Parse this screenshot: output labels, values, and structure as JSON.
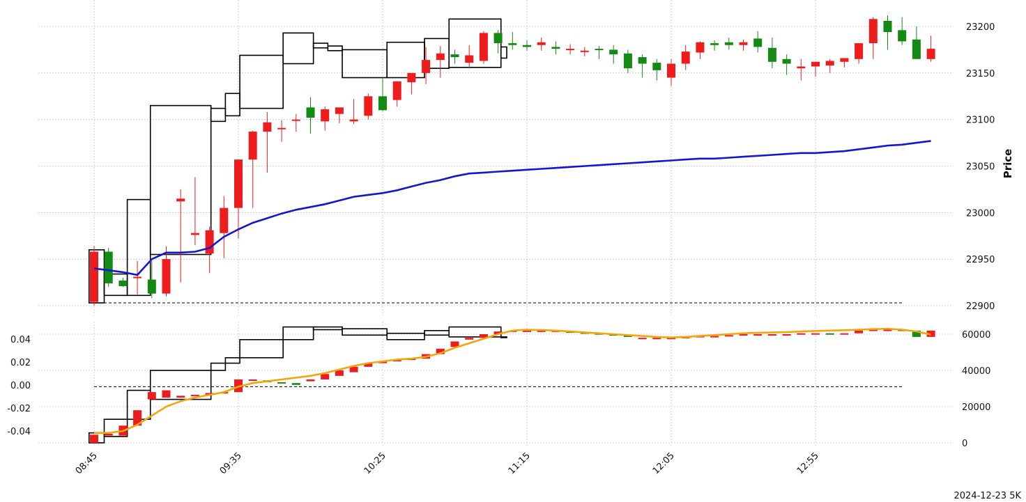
{
  "footer": "2024-12-23 5K",
  "colors": {
    "up": "#ee1c1c",
    "down": "#138a13",
    "ma": "#1414d4",
    "cum": "#f5a40c",
    "box": "#000000",
    "grid": "#b0b0b0"
  },
  "chart_data": [
    {
      "type": "candlestick",
      "title": "",
      "xlabel": "",
      "ylabel": "Price",
      "ylim": [
        22890,
        23230
      ],
      "yticks": [
        22900,
        22950,
        23000,
        23050,
        23100,
        23150,
        23200
      ],
      "xticks": [
        "08:45",
        "09:35",
        "10:25",
        "11:15",
        "12:05",
        "12:55"
      ],
      "grid": true,
      "reference_line": 22903,
      "time": [
        "08:45",
        "08:50",
        "08:55",
        "09:00",
        "09:05",
        "09:10",
        "09:15",
        "09:20",
        "09:25",
        "09:30",
        "09:35",
        "09:40",
        "09:45",
        "09:50",
        "09:55",
        "10:00",
        "10:05",
        "10:10",
        "10:15",
        "10:20",
        "10:25",
        "10:30",
        "10:35",
        "10:40",
        "10:45",
        "10:50",
        "10:55",
        "11:00",
        "11:05",
        "11:10",
        "11:15",
        "11:20",
        "11:25",
        "11:30",
        "11:35",
        "11:40",
        "11:45",
        "11:50",
        "11:55",
        "12:00",
        "12:05",
        "12:10",
        "12:15",
        "12:20",
        "12:25",
        "12:30",
        "12:35",
        "12:40",
        "12:45",
        "12:50",
        "12:55",
        "13:00",
        "13:05",
        "13:10",
        "13:15",
        "13:20",
        "13:25"
      ],
      "open": [
        22904,
        22958,
        22927,
        22931,
        22928,
        22913,
        23012,
        22976,
        22956,
        22978,
        23005,
        23057,
        23087,
        23091,
        23099,
        23113,
        23098,
        23106,
        23098,
        23104,
        23125,
        23121,
        23140,
        23150,
        23164,
        23170,
        23161,
        23163,
        23193,
        23182,
        23180,
        23180,
        23178,
        23175,
        23174,
        23176,
        23175,
        23171,
        23167,
        23161,
        23145,
        23160,
        23172,
        23182,
        23183,
        23180,
        23187,
        23177,
        23165,
        23155,
        23157,
        23158,
        23162,
        23165,
        23182,
        23206,
        23196,
        23186,
        23165
      ],
      "high": [
        22964,
        22962,
        22930,
        22948,
        22948,
        22964,
        23025,
        23038,
        22985,
        23018,
        23040,
        23088,
        23108,
        23099,
        23106,
        23124,
        23114,
        23109,
        23122,
        23128,
        23145,
        23139,
        23148,
        23178,
        23179,
        23175,
        23180,
        23195,
        23196,
        23194,
        23185,
        23188,
        23184,
        23181,
        23178,
        23179,
        23180,
        23175,
        23170,
        23165,
        23165,
        23180,
        23184,
        23185,
        23188,
        23186,
        23195,
        23188,
        23170,
        23165,
        23160,
        23165,
        23166,
        23175,
        23210,
        23212,
        23210,
        23200,
        23190
      ],
      "low": [
        22900,
        22920,
        22920,
        22912,
        22908,
        22910,
        22925,
        22965,
        22935,
        22951,
        22972,
        23005,
        23043,
        23076,
        23087,
        23085,
        23088,
        23096,
        23095,
        23100,
        23109,
        23114,
        23127,
        23138,
        23145,
        23160,
        23155,
        23160,
        23171,
        23175,
        23174,
        23174,
        23170,
        23170,
        23168,
        23165,
        23160,
        23150,
        23145,
        23142,
        23136,
        23153,
        23165,
        23174,
        23175,
        23174,
        23172,
        23155,
        23148,
        23142,
        23146,
        23150,
        23156,
        23160,
        23165,
        23175,
        23180,
        23178,
        23162
      ],
      "close": [
        22958,
        22924,
        22921,
        22931,
        22913,
        22950,
        23015,
        22978,
        22981,
        23005,
        23057,
        23087,
        23097,
        23091,
        23100,
        23102,
        23111,
        23113,
        23100,
        23125,
        23110,
        23141,
        23150,
        23164,
        23171,
        23167,
        23169,
        23193,
        23182,
        23180,
        23178,
        23183,
        23176,
        23176,
        23174,
        23175,
        23170,
        23155,
        23160,
        23153,
        23160,
        23173,
        23183,
        23180,
        23180,
        23183,
        23178,
        23162,
        23160,
        23157,
        23162,
        23163,
        23166,
        23182,
        23208,
        23194,
        23184,
        23165,
        23176
      ],
      "vwap": [
        22940,
        22938,
        22936,
        22933,
        22950,
        22957,
        22957,
        22958,
        22962,
        22974,
        22982,
        22989,
        22994,
        22999,
        23003,
        23006,
        23009,
        23013,
        23017,
        23019,
        23021,
        23024,
        23028,
        23032,
        23035,
        23039,
        23042,
        23043,
        23044,
        23045,
        23046,
        23047,
        23048,
        23049,
        23050,
        23051,
        23052,
        23053,
        23054,
        23055,
        23056,
        23057,
        23058,
        23058,
        23059,
        23060,
        23061,
        23062,
        23063,
        23064,
        23064,
        23065,
        23066,
        23068,
        23070,
        23072,
        23073,
        23075,
        23077
      ],
      "boxes": [
        {
          "t0": -0.35,
          "t1": 0.7,
          "low": 22903,
          "high": 22960
        },
        {
          "t0": 0.7,
          "t1": 2.3,
          "low": 22911,
          "high": 22934
        },
        {
          "t0": 2.3,
          "t1": 3.9,
          "low": 22911,
          "high": 23014
        },
        {
          "t0": 3.9,
          "t1": 8.1,
          "low": 22955,
          "high": 23115
        },
        {
          "t0": 8.1,
          "t1": 9.1,
          "low": 23098,
          "high": 23112
        },
        {
          "t0": 9.1,
          "t1": 10.1,
          "low": 23104,
          "high": 23128
        },
        {
          "t0": 10.1,
          "t1": 13.1,
          "low": 23112,
          "high": 23169
        },
        {
          "t0": 13.1,
          "t1": 15.2,
          "low": 23160,
          "high": 23193
        },
        {
          "t0": 15.2,
          "t1": 16.2,
          "low": 23177,
          "high": 23182
        },
        {
          "t0": 16.2,
          "t1": 17.2,
          "low": 23174,
          "high": 23179
        },
        {
          "t0": 17.2,
          "t1": 20.3,
          "low": 23145,
          "high": 23175
        },
        {
          "t0": 20.3,
          "t1": 22.9,
          "low": 23145,
          "high": 23183
        },
        {
          "t0": 22.9,
          "t1": 24.6,
          "low": 23155,
          "high": 23187
        },
        {
          "t0": 24.6,
          "t1": 28.2,
          "low": 23156,
          "high": 23208
        },
        {
          "t0": 28.2,
          "t1": 28.6,
          "low": 23166,
          "high": 23178
        }
      ]
    },
    {
      "type": "candlestick",
      "title": "",
      "xlabel": "",
      "ylabel": "",
      "ylim_left": [
        -0.05,
        0.048
      ],
      "yticks_left": [
        "-0.04",
        "-0.02",
        "0.00",
        "0.02",
        "0.04"
      ],
      "ylim_right": [
        -3000,
        64500
      ],
      "yticks_right": [
        0,
        20000,
        40000,
        60000
      ],
      "reference_line": 31000,
      "grid": true,
      "open": [
        0,
        4000,
        4000,
        9500,
        24000,
        25000,
        25000,
        26000,
        26500,
        27500,
        28000,
        35000,
        34500,
        33500,
        33000,
        34000,
        35000,
        37000,
        39000,
        42000,
        44000,
        45000,
        46000,
        46500,
        49000,
        53000,
        57000,
        58000,
        60000,
        61500,
        62000,
        62000,
        62000,
        61500,
        61000,
        60500,
        60000,
        59500,
        58000,
        58000,
        58000,
        58000,
        58500,
        59000,
        59000,
        59500,
        60000,
        60000,
        60000,
        60000,
        60500,
        60500,
        60000,
        60500,
        62000,
        62500,
        62500,
        62000,
        58500
      ],
      "close": [
        4500,
        5000,
        9500,
        18000,
        28000,
        29000,
        26000,
        26500,
        27500,
        28000,
        35000,
        35000,
        33500,
        33000,
        32000,
        35000,
        38000,
        40000,
        42000,
        44000,
        45000,
        46000,
        46500,
        49000,
        52000,
        56000,
        58000,
        60000,
        61500,
        62000,
        62000,
        62000,
        62000,
        61000,
        60500,
        60000,
        59500,
        58500,
        58000,
        58000,
        58000,
        58500,
        59000,
        59000,
        59500,
        60000,
        60000,
        60000,
        60000,
        60500,
        60500,
        60000,
        60500,
        62000,
        62500,
        62500,
        62000,
        58500,
        62000
      ],
      "line": [
        5500,
        5500,
        6500,
        10000,
        15000,
        20000,
        23000,
        25000,
        26500,
        28000,
        31000,
        33000,
        34000,
        35000,
        36000,
        37000,
        38500,
        40500,
        42500,
        44000,
        45000,
        46000,
        46500,
        47500,
        49500,
        52500,
        55000,
        57500,
        60000,
        62000,
        62500,
        62300,
        62000,
        61500,
        61000,
        60500,
        60000,
        59500,
        59000,
        58500,
        58200,
        58500,
        59000,
        59500,
        60000,
        60500,
        60800,
        61000,
        61200,
        61500,
        61800,
        62000,
        62200,
        62500,
        62800,
        63000,
        62500,
        61500,
        59800
      ],
      "boxes": [
        {
          "t0": -0.35,
          "t1": 0.7,
          "low": 0,
          "high": 5500
        },
        {
          "t0": 0.7,
          "t1": 2.3,
          "low": 3500,
          "high": 13000
        },
        {
          "t0": 2.3,
          "t1": 3.9,
          "low": 13000,
          "high": 29000
        },
        {
          "t0": 3.9,
          "t1": 8.1,
          "low": 24000,
          "high": 40000
        },
        {
          "t0": 8.1,
          "t1": 9.1,
          "low": 40000,
          "high": 44000
        },
        {
          "t0": 9.1,
          "t1": 10.1,
          "low": 44000,
          "high": 47000
        },
        {
          "t0": 10.1,
          "t1": 13.1,
          "low": 47000,
          "high": 57000
        },
        {
          "t0": 13.1,
          "t1": 15.2,
          "low": 57000,
          "high": 64000
        },
        {
          "t0": 15.2,
          "t1": 17.2,
          "low": 62500,
          "high": 64000
        },
        {
          "t0": 17.2,
          "t1": 20.3,
          "low": 59500,
          "high": 63000
        },
        {
          "t0": 20.3,
          "t1": 22.9,
          "low": 57000,
          "high": 60500
        },
        {
          "t0": 22.9,
          "t1": 24.6,
          "low": 59500,
          "high": 62000
        },
        {
          "t0": 24.6,
          "t1": 28.2,
          "low": 58500,
          "high": 64000
        },
        {
          "t0": 28.2,
          "t1": 28.6,
          "low": 58500,
          "high": 58500
        }
      ]
    }
  ]
}
